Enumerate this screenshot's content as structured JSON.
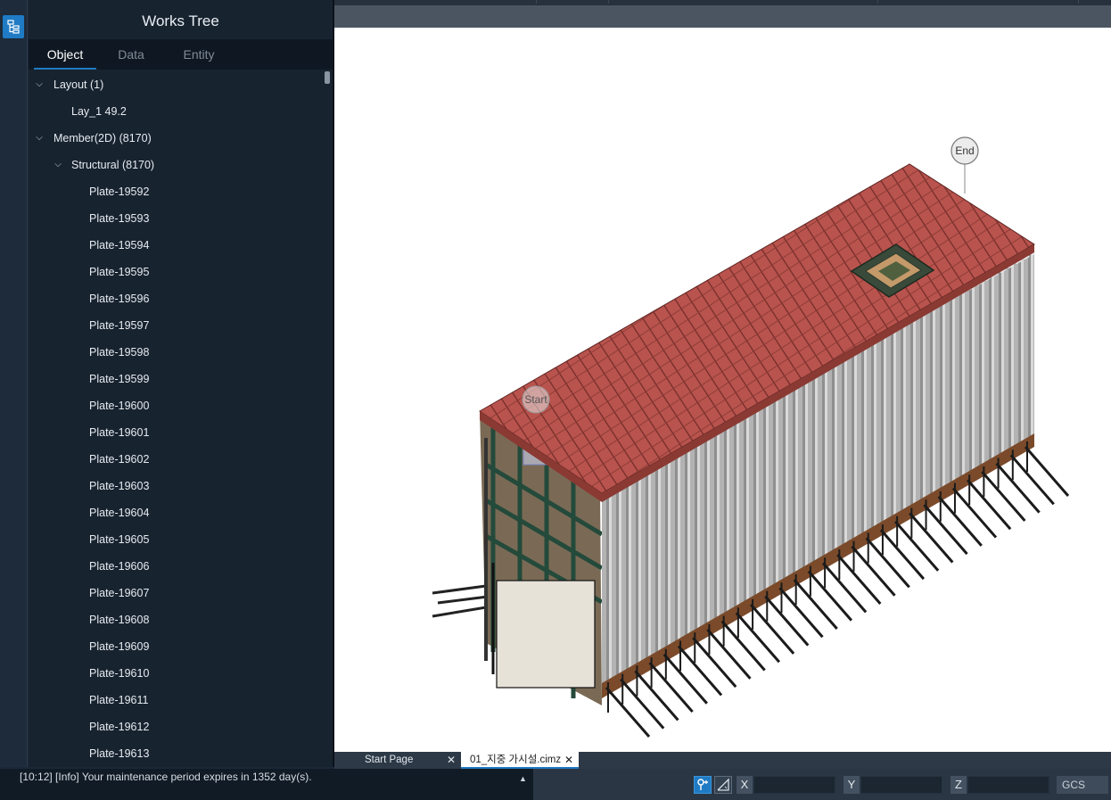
{
  "panel": {
    "title": "Works Tree",
    "tabs": [
      "Object",
      "Data",
      "Entity"
    ],
    "active_tab": "Object"
  },
  "tree": {
    "layout_group": "Layout (1)",
    "layout_item": "Lay_1 49.2",
    "member_group": "Member(2D) (8170)",
    "structural_group": "Structural (8170)",
    "plates": [
      "Plate-19592",
      "Plate-19593",
      "Plate-19594",
      "Plate-19595",
      "Plate-19596",
      "Plate-19597",
      "Plate-19598",
      "Plate-19599",
      "Plate-19600",
      "Plate-19601",
      "Plate-19602",
      "Plate-19603",
      "Plate-19604",
      "Plate-19605",
      "Plate-19606",
      "Plate-19607",
      "Plate-19608",
      "Plate-19609",
      "Plate-19610",
      "Plate-19611",
      "Plate-19612",
      "Plate-19613"
    ]
  },
  "viewport": {
    "start_marker": "Start",
    "end_marker": "End"
  },
  "doc_tabs": {
    "start_page": "Start Page",
    "file": "01_지중 가시설.cimz",
    "close_glyph": "✕"
  },
  "status": {
    "message": "[10:12] [Info] Your maintenance period expires in 1352 day(s).",
    "expand_glyph": "▲",
    "axis_x": "X",
    "axis_y": "Y",
    "axis_z": "Z",
    "coord_system": "GCS"
  },
  "colors": {
    "accent": "#1f7bc4",
    "deck": "#b5504b",
    "wall": "#a7a7a7"
  }
}
